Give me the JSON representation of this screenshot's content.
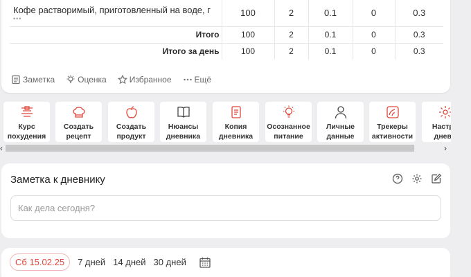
{
  "table": {
    "item": {
      "name": "Кофе растворимый, приготовленный на воде, г",
      "more": "•••",
      "values": [
        "100",
        "2",
        "0.1",
        "0",
        "0.3"
      ]
    },
    "total": {
      "label": "Итого",
      "values": [
        "100",
        "2",
        "0.1",
        "0",
        "0.3"
      ]
    },
    "day_total": {
      "label": "Итого за день",
      "values": [
        "100",
        "2",
        "0.1",
        "0",
        "0.3"
      ]
    }
  },
  "actions": {
    "note": "Заметка",
    "rating": "Оценка",
    "favorite": "Избранное",
    "more": "Ещё"
  },
  "quick_tiles": [
    {
      "label": "Курс\nпохудения",
      "icon": "scale-icon"
    },
    {
      "label": "Создать\nрецепт",
      "icon": "chef-hat-icon"
    },
    {
      "label": "Создать\nпродукт",
      "icon": "apple-icon"
    },
    {
      "label": "Нюансы\nдневника",
      "icon": "book-icon"
    },
    {
      "label": "Копия\nдневника",
      "icon": "document-icon"
    },
    {
      "label": "Осознанное\nпитание",
      "icon": "lightbulb-icon"
    },
    {
      "label": "Личные\nданные",
      "icon": "person-icon"
    },
    {
      "label": "Трекеры\nактивности",
      "icon": "tracker-icon"
    },
    {
      "label": "Настро\nдневн",
      "icon": "gear-icon"
    }
  ],
  "note_card": {
    "title": "Заметка к дневнику",
    "placeholder": "Как дела сегодня?"
  },
  "dates": {
    "current": "Сб 15.02.25",
    "r7": "7 дней",
    "r14": "14 дней",
    "r30": "30 дней"
  },
  "colors": {
    "accent": "#e0453a",
    "background": "#eeeef0"
  }
}
